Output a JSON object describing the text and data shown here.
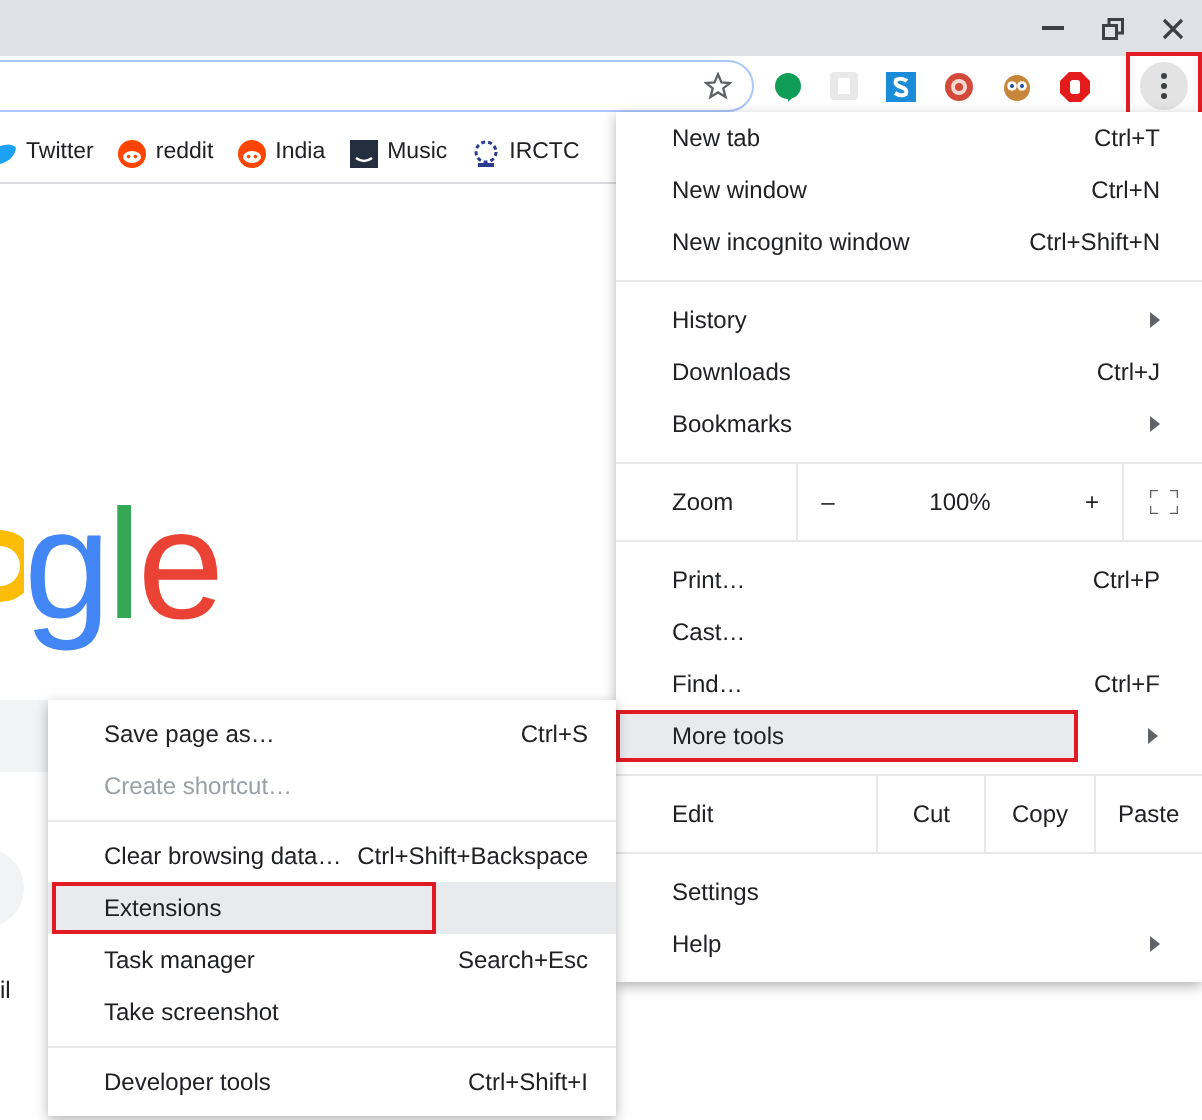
{
  "bookmarks": [
    {
      "kind": "bird",
      "label": "Twitter"
    },
    {
      "kind": "reddit",
      "label": "reddit"
    },
    {
      "kind": "reddit",
      "label": "India"
    },
    {
      "kind": "music",
      "label": "Music"
    },
    {
      "kind": "emblem",
      "label": "IRCTC"
    }
  ],
  "page": {
    "logo_text": "gle",
    "tile_label": "il"
  },
  "menu": {
    "sections": [
      {
        "items": [
          {
            "kind": "item",
            "label": "New tab",
            "shortcut": "Ctrl+T",
            "submenu": false,
            "selected": false,
            "highlighted": false
          },
          {
            "kind": "item",
            "label": "New window",
            "shortcut": "Ctrl+N",
            "submenu": false,
            "selected": false,
            "highlighted": false
          },
          {
            "kind": "item",
            "label": "New incognito window",
            "shortcut": "Ctrl+Shift+N",
            "submenu": false,
            "selected": false,
            "highlighted": false
          }
        ]
      },
      {
        "items": [
          {
            "kind": "item",
            "label": "History",
            "submenu": true,
            "selected": false,
            "highlighted": false
          },
          {
            "kind": "item",
            "label": "Downloads",
            "shortcut": "Ctrl+J",
            "submenu": false,
            "selected": false,
            "highlighted": false
          },
          {
            "kind": "item",
            "label": "Bookmarks",
            "submenu": true,
            "selected": false,
            "highlighted": false
          }
        ]
      },
      {
        "items": [
          {
            "kind": "zoom",
            "label": "Zoom",
            "minus": "–",
            "value": "100%",
            "plus": "+"
          }
        ]
      },
      {
        "items": [
          {
            "kind": "item",
            "label": "Print…",
            "shortcut": "Ctrl+P",
            "submenu": false,
            "selected": false,
            "highlighted": false
          },
          {
            "kind": "item",
            "label": "Cast…",
            "submenu": false,
            "selected": false,
            "highlighted": false
          },
          {
            "kind": "item",
            "label": "Find…",
            "shortcut": "Ctrl+F",
            "submenu": false,
            "selected": false,
            "highlighted": false
          },
          {
            "kind": "item",
            "label": "More tools",
            "submenu": true,
            "selected": true,
            "highlighted": true
          }
        ]
      },
      {
        "items": [
          {
            "kind": "edit",
            "label": "Edit",
            "actions": [
              "Cut",
              "Copy",
              "Paste"
            ]
          }
        ]
      },
      {
        "items": [
          {
            "kind": "item",
            "label": "Settings",
            "submenu": false,
            "selected": false,
            "highlighted": false
          },
          {
            "kind": "item",
            "label": "Help",
            "submenu": true,
            "selected": false,
            "highlighted": false
          }
        ]
      }
    ]
  },
  "submenu": {
    "sections": [
      {
        "items": [
          {
            "label": "Save page as…",
            "shortcut": "Ctrl+S",
            "disabled": false,
            "selected": false,
            "highlighted": false
          },
          {
            "label": "Create shortcut…",
            "disabled": true,
            "selected": false,
            "highlighted": false
          }
        ]
      },
      {
        "items": [
          {
            "label": "Clear browsing data…",
            "shortcut": "Ctrl+Shift+Backspace",
            "disabled": false,
            "selected": false,
            "highlighted": false
          },
          {
            "label": "Extensions",
            "disabled": false,
            "selected": true,
            "highlighted": true
          },
          {
            "label": "Task manager",
            "shortcut": "Search+Esc",
            "disabled": false,
            "selected": false,
            "highlighted": false
          },
          {
            "label": "Take screenshot",
            "disabled": false,
            "selected": false,
            "highlighted": false
          }
        ]
      },
      {
        "items": [
          {
            "label": "Developer tools",
            "shortcut": "Ctrl+Shift+I",
            "disabled": false,
            "selected": false,
            "highlighted": false
          }
        ]
      }
    ]
  }
}
